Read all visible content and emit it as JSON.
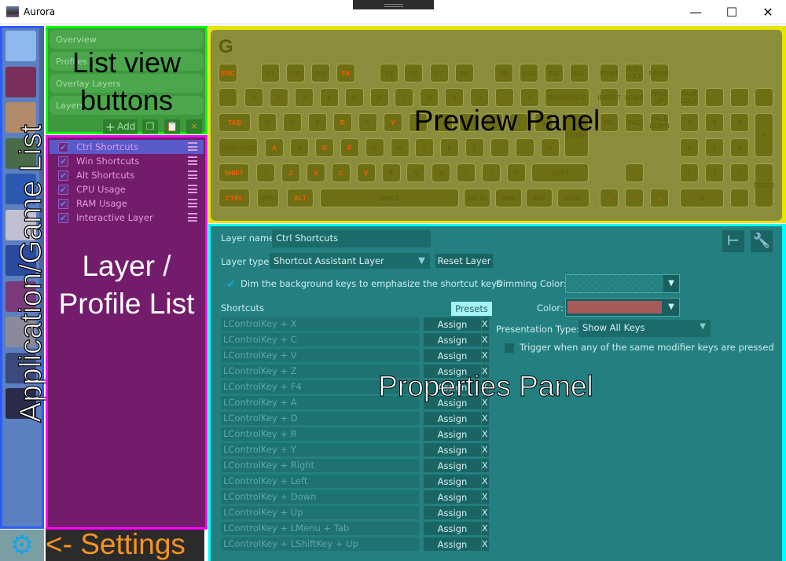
{
  "window": {
    "title": "Aurora",
    "minimize": "—",
    "maximize": "☐",
    "close": "✕"
  },
  "annotations": {
    "app_list": "Application/Game List",
    "list_view": "List view buttons",
    "layer_list": "Layer / Profile List",
    "preview": "Preview Panel",
    "properties": "Properties Panel",
    "settings": "<- Settings"
  },
  "app_list": {
    "items": [
      "desktop",
      "dota-2",
      "csgo",
      "gta-v",
      "rocket-league",
      "overwatch",
      "league-of-legends",
      "pd2",
      "blackout",
      "cod",
      "payday"
    ]
  },
  "list_view": {
    "buttons": [
      "Overview",
      "Profiles",
      "Overlay Layers",
      "Layers"
    ],
    "add_label": "Add",
    "add_icon": "+",
    "copy_icon": "copy-icon",
    "paste_icon": "paste-icon",
    "delete_icon": "✕"
  },
  "layers": [
    {
      "name": "Ctrl Shortcuts",
      "enabled": true,
      "selected": true
    },
    {
      "name": "Win Shortcuts",
      "enabled": true
    },
    {
      "name": "Alt Shortcuts",
      "enabled": true
    },
    {
      "name": "CPU Usage",
      "enabled": true
    },
    {
      "name": "RAM Usage",
      "enabled": true
    },
    {
      "name": "Interactive Layer",
      "enabled": true
    }
  ],
  "keyboard": {
    "logo": "G",
    "highlight_color": "#ff5a00",
    "keys": [
      [
        "ESC",
        1
      ],
      [
        "F1",
        0
      ],
      [
        "F2",
        0
      ],
      [
        "F3",
        0
      ],
      [
        "F4",
        1
      ],
      [
        "F5",
        0
      ],
      [
        "F6",
        0
      ],
      [
        "F7",
        0
      ],
      [
        "F8",
        0
      ],
      [
        "F9",
        0
      ],
      [
        "F10",
        0
      ],
      [
        "F11",
        0
      ],
      [
        "F12",
        0
      ],
      [
        "PRINT",
        0
      ],
      [
        "SCRL LOCK",
        0
      ],
      [
        "PAUSE",
        0
      ],
      [
        "~",
        0
      ],
      [
        "1",
        0
      ],
      [
        "2",
        0
      ],
      [
        "3",
        0
      ],
      [
        "4",
        0
      ],
      [
        "5",
        0
      ],
      [
        "6",
        0
      ],
      [
        "7",
        0
      ],
      [
        "8",
        0
      ],
      [
        "9",
        0
      ],
      [
        "0",
        0
      ],
      [
        "-",
        0
      ],
      [
        "=",
        0
      ],
      [
        "BACKSPACE",
        0
      ],
      [
        "INSERT",
        0
      ],
      [
        "HOME",
        0
      ],
      [
        "PAGE UP",
        0
      ],
      [
        "NUM LOCK",
        0
      ],
      [
        "/",
        0
      ],
      [
        "*",
        0
      ],
      [
        "-",
        0
      ],
      [
        "TAB",
        1
      ],
      [
        "Q",
        0
      ],
      [
        "W",
        0
      ],
      [
        "E",
        0
      ],
      [
        "R",
        1
      ],
      [
        "T",
        0
      ],
      [
        "Y",
        1
      ],
      [
        "U",
        0
      ],
      [
        "I",
        0
      ],
      [
        "O",
        0
      ],
      [
        "P",
        0
      ],
      [
        "{",
        0
      ],
      [
        "}",
        0
      ],
      [
        "ENTER",
        0
      ],
      [
        "DEL",
        0
      ],
      [
        "END",
        0
      ],
      [
        "PAGE DOWN",
        0
      ],
      [
        "7",
        0
      ],
      [
        "8",
        0
      ],
      [
        "9",
        0
      ],
      [
        "+",
        0
      ],
      [
        "CAPS LOCK",
        0
      ],
      [
        "A",
        1
      ],
      [
        "S",
        0
      ],
      [
        "D",
        1
      ],
      [
        "F",
        1
      ],
      [
        "G",
        0
      ],
      [
        "H",
        0
      ],
      [
        "J",
        0
      ],
      [
        "K",
        0
      ],
      [
        "L",
        0
      ],
      [
        ":",
        0
      ],
      [
        "'",
        0
      ],
      [
        "#",
        0
      ],
      [
        "4",
        0
      ],
      [
        "5",
        0
      ],
      [
        "6",
        0
      ],
      [
        "SHIFT",
        1
      ],
      [
        "\\",
        0
      ],
      [
        "Z",
        1
      ],
      [
        "X",
        1
      ],
      [
        "C",
        1
      ],
      [
        "V",
        1
      ],
      [
        "B",
        0
      ],
      [
        "N",
        0
      ],
      [
        "M",
        0
      ],
      [
        "<",
        0
      ],
      [
        ">",
        0
      ],
      [
        "?",
        0
      ],
      [
        "SHIFT",
        0
      ],
      [
        "↑",
        1
      ],
      [
        "1",
        0
      ],
      [
        "2",
        0
      ],
      [
        "3",
        0
      ],
      [
        "ENTER",
        0
      ],
      [
        "CTRL",
        1
      ],
      [
        "WIN",
        0
      ],
      [
        "ALT",
        1
      ],
      [
        "SPACE",
        0
      ],
      [
        "ALT Gr",
        0
      ],
      [
        "WIN",
        0
      ],
      [
        "APP",
        0
      ],
      [
        "CTRL",
        0
      ],
      [
        "←",
        1
      ],
      [
        "↓",
        1
      ],
      [
        "→",
        1
      ],
      [
        "0",
        0
      ],
      [
        ".",
        0
      ]
    ]
  },
  "properties": {
    "layer_name_label": "Layer name:",
    "layer_name": "Ctrl Shortcuts",
    "layer_type_label": "Layer type:",
    "layer_type": "Shortcut Assistant Layer",
    "reset_label": "Reset Layer",
    "dim_label": "Dim the background keys to emphasize the shortcut keys",
    "dim_checked": true,
    "dimming_color_label": "Dimming Color:",
    "color_label": "Color:",
    "color": "#a65b5a",
    "shortcuts_label": "Shortcuts",
    "presets_label": "Presets",
    "presentation_label": "Presentation Type:",
    "presentation": "Show All Keys",
    "trigger_label": "Trigger when any of the same modifier keys are pressed",
    "trigger_checked": false,
    "assign_label": "Assign",
    "remove_label": "X",
    "shortcuts": [
      "LControlKey + X",
      "LControlKey + C",
      "LControlKey + V",
      "LControlKey + Z",
      "LControlKey + F4",
      "LControlKey + A",
      "LControlKey + D",
      "LControlKey + R",
      "LControlKey + Y",
      "LControlKey + Right",
      "LControlKey + Left",
      "LControlKey + Down",
      "LControlKey + Up",
      "LControlKey + LMenu + Tab",
      "LControlKey + LShiftKey + Up"
    ]
  },
  "colors": {
    "app_list_border": "#2b5cff",
    "list_view_border": "#00ff00",
    "layer_list_border": "#ff00ff",
    "preview_border": "#e6e600",
    "properties_border": "#00ffff",
    "settings_text": "#f7931e"
  }
}
